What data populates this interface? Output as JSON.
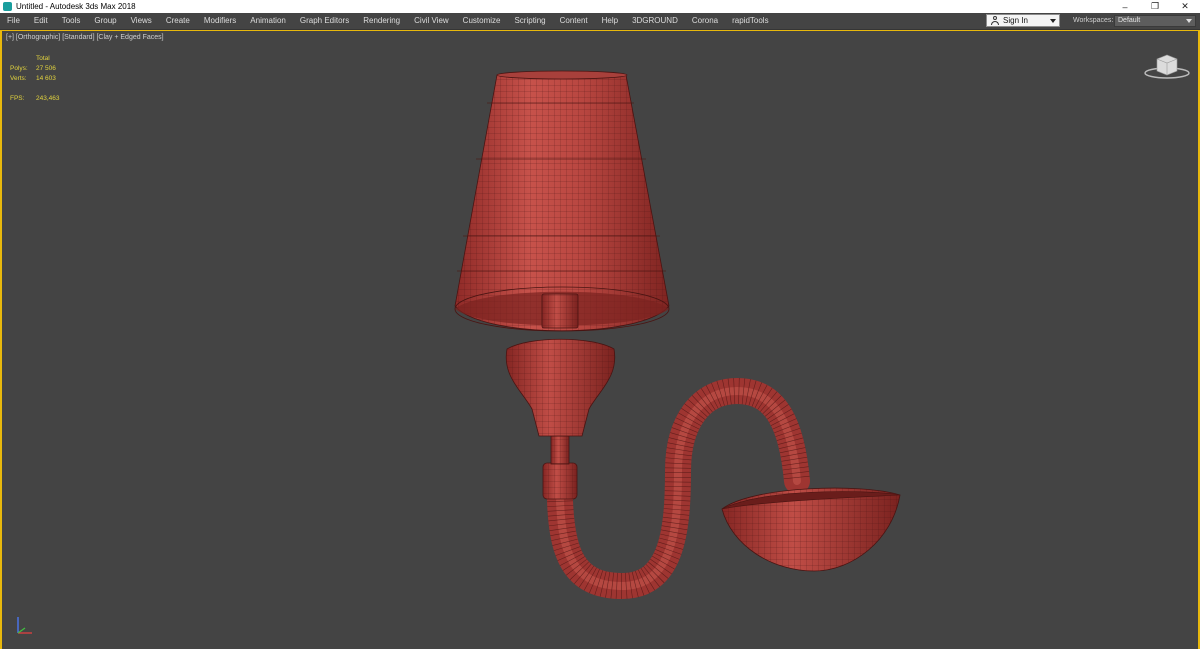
{
  "window": {
    "title": "Untitled - Autodesk 3ds Max 2018",
    "controls": [
      "–",
      "❐",
      "✕"
    ]
  },
  "menu": {
    "items": [
      "File",
      "Edit",
      "Tools",
      "Group",
      "Views",
      "Create",
      "Modifiers",
      "Animation",
      "Graph Editors",
      "Rendering",
      "Civil View",
      "Customize",
      "Scripting",
      "Content",
      "Help",
      "3DGROUND",
      "Corona",
      "rapidTools"
    ]
  },
  "account": {
    "signin_label": "Sign In"
  },
  "workspaces": {
    "label": "Workspaces:",
    "value": "Default"
  },
  "viewport": {
    "label": "[+] [Orthographic] [Standard] [Clay + Edged Faces]",
    "stats": {
      "header": "Total",
      "polys_label": "Polys:",
      "polys_value": "27 506",
      "verts_label": "Verts:",
      "verts_value": "14 603",
      "fps_label": "FPS:",
      "fps_value": "243,463"
    },
    "model": {
      "name": "wall-lamp",
      "color": "#b23c38"
    },
    "border_color": "#e8b80c"
  },
  "icons": {
    "app": "3ds-max-icon",
    "user": "user-icon",
    "viewcube": "viewcube-icon",
    "axis": "axis-tripod-icon"
  }
}
